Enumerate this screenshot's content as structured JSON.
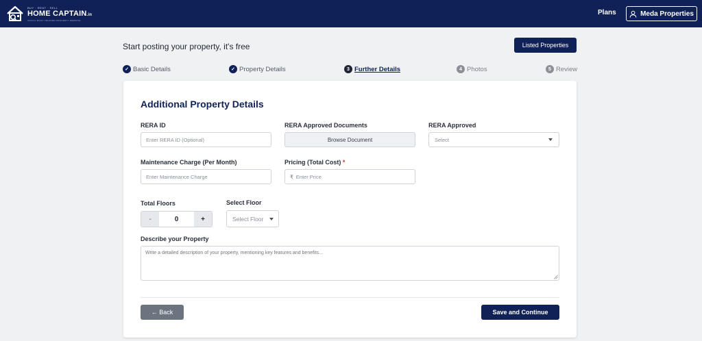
{
  "brand": {
    "small_text": "BUY · RENT · SELL",
    "name": "HOME CAPTAIN",
    "tld": ".in",
    "tagline": "INDIA'S MOST TRUSTED PROPERTY WEBSITE"
  },
  "nav": {
    "plans": "Plans",
    "account": "Meda Properties"
  },
  "intro": "Start posting your property, it's free",
  "listed_button": "Listed Properties",
  "steps": [
    {
      "num": "✓",
      "label": "Basic Details",
      "state": "done"
    },
    {
      "num": "✓",
      "label": "Property Details",
      "state": "done"
    },
    {
      "num": "3",
      "label": "Further Details",
      "state": "active"
    },
    {
      "num": "4",
      "label": "Photos",
      "state": "todo"
    },
    {
      "num": "5",
      "label": "Review",
      "state": "todo"
    }
  ],
  "form": {
    "title": "Additional Property Details",
    "rera_id": {
      "label": "RERA ID",
      "placeholder": "Enter RERA ID (Optional)"
    },
    "rera_docs": {
      "label": "RERA Approved Documents",
      "button": "Browse Document"
    },
    "rera_approved": {
      "label": "RERA Approved",
      "selected": "Select"
    },
    "maintenance": {
      "label": "Maintenance Charge (Per Month)",
      "placeholder": "Enter Maintenance Charge"
    },
    "pricing": {
      "label": "Pricing (Total Cost)",
      "required": "*",
      "currency": "₹",
      "placeholder": "Enter Price"
    },
    "total_floors": {
      "label": "Total Floors",
      "minus": "-",
      "value": "0",
      "plus": "+"
    },
    "select_floor": {
      "label": "Select Floor",
      "selected": "Select Floor"
    },
    "description": {
      "label": "Describe your Property",
      "placeholder": "Write a detailed description of your property, mentioning key features and benefits..."
    },
    "back": "← Back",
    "save": "Save and Continue"
  },
  "colors": {
    "primary": "#0f2157",
    "background": "#f0f1f3",
    "back_button": "#6c7480"
  }
}
